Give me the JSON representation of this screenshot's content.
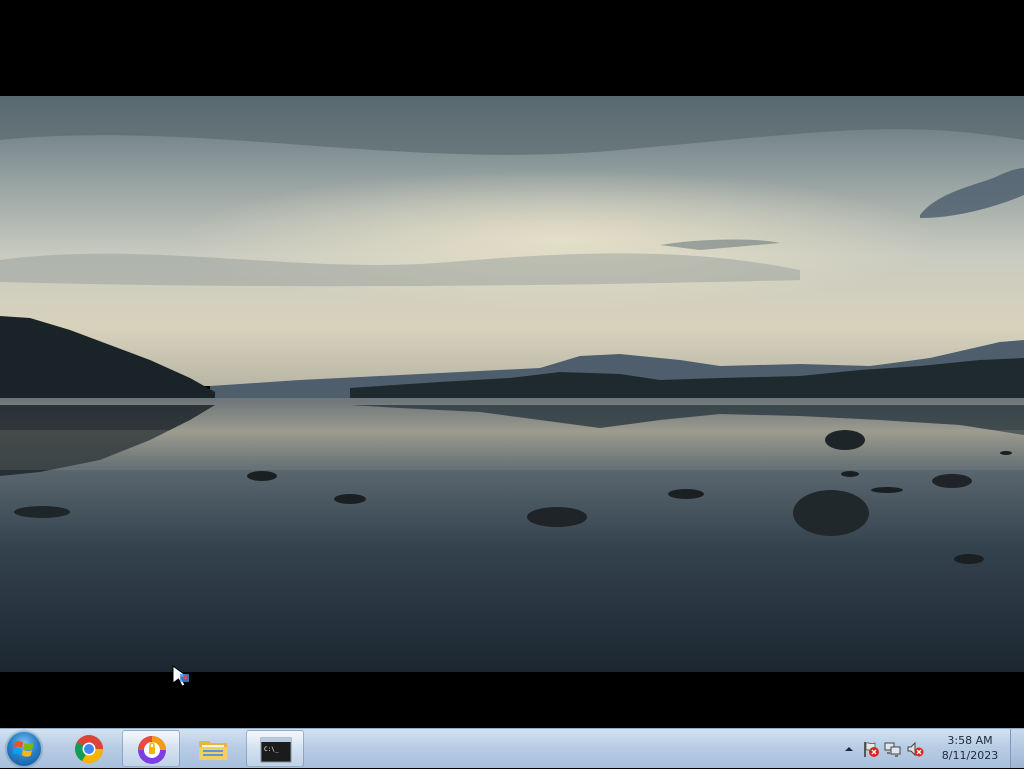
{
  "desktop": {
    "wallpaper": "lake-landscape-wallpaper"
  },
  "taskbar": {
    "start_button": {
      "icon": "windows-logo-icon"
    },
    "pinned": [
      {
        "name": "chrome",
        "icon": "chrome-icon",
        "active": false
      },
      {
        "name": "browser-app",
        "icon": "browser-app-icon",
        "active": true
      },
      {
        "name": "file-explorer",
        "icon": "folder-icon",
        "active": false
      },
      {
        "name": "command-prompt",
        "icon": "cmd-icon",
        "active": true
      }
    ],
    "tray": {
      "icons": [
        "show-hidden-icons-arrow",
        "action-center-flag-icon",
        "network-icon",
        "volume-muted-icon"
      ],
      "time": "3:58 AM",
      "date": "8/11/2023"
    }
  },
  "colors": {
    "taskbar_top": "#d3e2f2",
    "taskbar_bottom": "#a8c0dc",
    "sky": "#c9cfc9",
    "water": "#2a3642"
  }
}
